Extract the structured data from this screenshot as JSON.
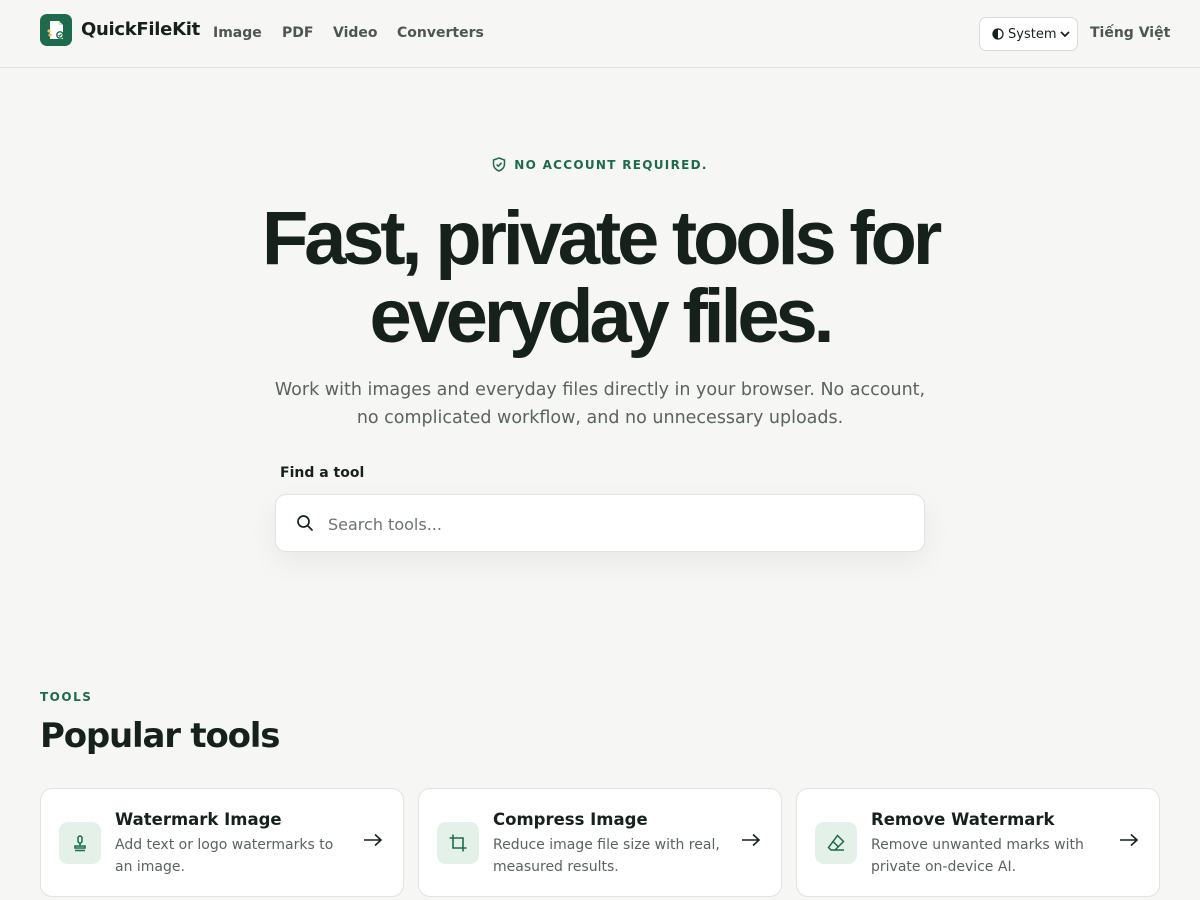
{
  "header": {
    "brand": "QuickFileKit",
    "nav": [
      {
        "label": "Image"
      },
      {
        "label": "PDF"
      },
      {
        "label": "Video"
      },
      {
        "label": "Converters"
      }
    ],
    "theme_select": {
      "value": "System",
      "icon": "half-circle-icon"
    },
    "language": "Tiếng Việt"
  },
  "hero": {
    "eyebrow": "NO ACCOUNT REQUIRED.",
    "eyebrow_icon": "shield-check-icon",
    "title_line1": "Fast, private tools for",
    "title_line2": "everyday files.",
    "subtitle": "Work with images and everyday files directly in your browser. No account, no complicated workflow, and no unnecessary uploads.",
    "search_label": "Find a tool",
    "search_placeholder": "Search tools...",
    "search_value": ""
  },
  "tools": {
    "eyebrow": "TOOLS",
    "title": "Popular tools",
    "cards": [
      {
        "title": "Watermark Image",
        "description": "Add text or logo watermarks to an image.",
        "icon": "stamp-icon"
      },
      {
        "title": "Compress Image",
        "description": "Reduce image file size with real, measured results.",
        "icon": "crop-icon"
      },
      {
        "title": "Remove Watermark",
        "description": "Remove unwanted marks with private on-device AI.",
        "icon": "eraser-icon"
      }
    ]
  },
  "colors": {
    "accent": "#1d6b4c",
    "icon_bg": "#e3f1e9",
    "page_bg": "#f6f6f4",
    "text": "#17211c",
    "muted": "#5a635e"
  }
}
